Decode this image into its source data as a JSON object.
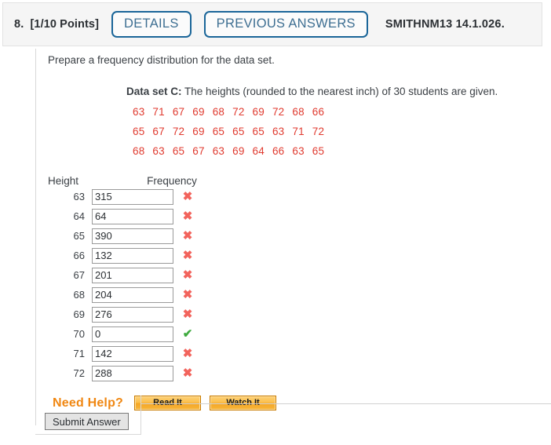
{
  "header": {
    "question_number": "8.",
    "points": "[1/10 Points]",
    "details_label": "DETAILS",
    "previous_answers_label": "PREVIOUS ANSWERS",
    "assignment_code": "SMITHNM13 14.1.026."
  },
  "question": {
    "prompt": "Prepare a frequency distribution for the data set.",
    "dataset_label": "Data set C:",
    "dataset_description": " The heights (rounded to the nearest inch) of 30 students are given.",
    "data_rows": [
      [
        "63",
        "71",
        "67",
        "69",
        "68",
        "72",
        "69",
        "72",
        "68",
        "66"
      ],
      [
        "65",
        "67",
        "72",
        "69",
        "65",
        "65",
        "65",
        "63",
        "71",
        "72"
      ],
      [
        "68",
        "63",
        "65",
        "67",
        "63",
        "69",
        "64",
        "66",
        "63",
        "65"
      ]
    ]
  },
  "table": {
    "col_height_label": "Height",
    "col_frequency_label": "Frequency",
    "rows": [
      {
        "height": "63",
        "frequency": "315",
        "status": "wrong",
        "mark": "✖"
      },
      {
        "height": "64",
        "frequency": "64",
        "status": "wrong",
        "mark": "✖"
      },
      {
        "height": "65",
        "frequency": "390",
        "status": "wrong",
        "mark": "✖"
      },
      {
        "height": "66",
        "frequency": "132",
        "status": "wrong",
        "mark": "✖"
      },
      {
        "height": "67",
        "frequency": "201",
        "status": "wrong",
        "mark": "✖"
      },
      {
        "height": "68",
        "frequency": "204",
        "status": "wrong",
        "mark": "✖"
      },
      {
        "height": "69",
        "frequency": "276",
        "status": "wrong",
        "mark": "✖"
      },
      {
        "height": "70",
        "frequency": "0",
        "status": "right",
        "mark": "✔"
      },
      {
        "height": "71",
        "frequency": "142",
        "status": "wrong",
        "mark": "✖"
      },
      {
        "height": "72",
        "frequency": "288",
        "status": "wrong",
        "mark": "✖"
      }
    ]
  },
  "help": {
    "label": "Need Help?",
    "read_it_label": "Read It",
    "watch_it_label": "Watch It"
  },
  "submit": {
    "label": "Submit Answer"
  },
  "colors": {
    "data_red": "#e03a2f",
    "wrong_red": "#f2635c",
    "right_green": "#3faa3f",
    "help_orange": "#f08712",
    "button_blue": "#1b6699"
  }
}
